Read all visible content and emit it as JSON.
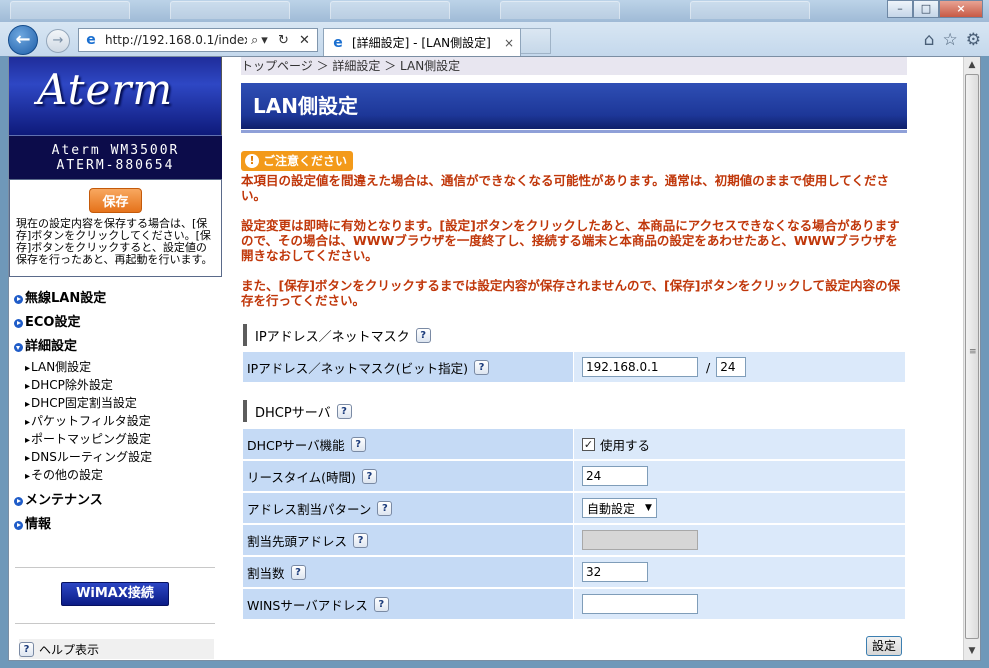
{
  "browser": {
    "url": "http://192.168.0.1/index",
    "tab_title": "[詳細設定] - [LAN側設定]",
    "tab_close": "×",
    "back_icon": "back-arrow-icon",
    "window_buttons": [
      "–",
      "□",
      "×"
    ]
  },
  "sidebar": {
    "logo": "Aterm",
    "model": "Aterm WM3500R",
    "device_name": "ATERM-880654",
    "save_button": "保存",
    "save_description": "現在の設定内容を保存する場合は、[保存]ボタンをクリックしてください。[保存]ボタンをクリックすると、設定値の保存を行ったあと、再起動を行います。",
    "menu": [
      {
        "label": "無線LAN設定"
      },
      {
        "label": "ECO設定"
      },
      {
        "label": "詳細設定"
      },
      {
        "label": "メンテナンス"
      },
      {
        "label": "情報"
      }
    ],
    "submenu": [
      "LAN側設定",
      "DHCP除外設定",
      "DHCP固定割当設定",
      "パケットフィルタ設定",
      "ポートマッピング設定",
      "DNSルーティング設定",
      "その他の設定"
    ],
    "wimax_button": "WiMAX接続",
    "help_label": "ヘルプ表示"
  },
  "main": {
    "breadcrumb": "トップページ ＞ 詳細設定 ＞ LAN側設定",
    "title": "LAN側設定",
    "caution_label": "ご注意ください",
    "warnings": [
      "本項目の設定値を間違えた場合は、通信ができなくなる可能性があります。通常は、初期値のままで使用してください。",
      "設定変更は即時に有効となります。[設定]ボタンをクリックしたあと、本商品にアクセスできなくなる場合がありますので、その場合は、WWWブラウザを一度終了し、接続する端末と本商品の設定をあわせたあと、WWWブラウザを開きなおしてください。",
      "また、[保存]ボタンをクリックするまでは設定内容が保存されませんので、[保存]ボタンをクリックして設定内容の保存を行ってください。"
    ],
    "section_ip": "IPアドレス／ネットマスク",
    "ip_row": {
      "label": "IPアドレス／ネットマスク(ビット指定)",
      "ip_value": "192.168.0.1",
      "slash": "/",
      "mask_value": "24"
    },
    "section_dhcp": "DHCPサーバ",
    "dhcp_rows": {
      "dhcp_function": {
        "label": "DHCPサーバ機能",
        "checkbox_label": "使用する",
        "checked": true
      },
      "lease_time": {
        "label": "リースタイム(時間)",
        "value": "24"
      },
      "assign_pattern": {
        "label": "アドレス割当パターン",
        "value": "自動設定"
      },
      "start_address": {
        "label": "割当先頭アドレス",
        "value": ""
      },
      "assign_count": {
        "label": "割当数",
        "value": "32"
      },
      "wins_address": {
        "label": "WINSサーバアドレス",
        "value": ""
      }
    },
    "help_mark": "?",
    "set_button": "設定"
  }
}
